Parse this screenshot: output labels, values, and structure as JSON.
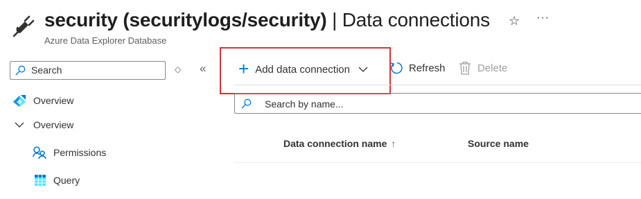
{
  "header": {
    "title_bold": "security (securitylogs/security)",
    "title_rest": " | Data connections",
    "subtitle": "Azure Data Explorer Database",
    "favorite_icon": "star-icon",
    "more_icon": "ellipsis-icon",
    "more_glyph": "···"
  },
  "sidebar": {
    "search_placeholder": "Search",
    "sort_glyph": "◇",
    "collapse_glyph": "«",
    "items": [
      {
        "label": "Overview",
        "icon": "overview-icon"
      },
      {
        "label": "Overview",
        "icon": "chevron-down-icon",
        "expanded": true
      },
      {
        "label": "Permissions",
        "icon": "permissions-icon"
      },
      {
        "label": "Query",
        "icon": "query-grid-icon"
      }
    ]
  },
  "toolbar": {
    "add_label": "Add data connection",
    "refresh_label": "Refresh",
    "delete_label": "Delete",
    "accent_color": "#0078d4",
    "highlight_color": "#d13438"
  },
  "main": {
    "search_placeholder": "Search by name...",
    "columns": [
      {
        "label": "Data connection name",
        "sort": "↑"
      },
      {
        "label": "Source name"
      }
    ]
  }
}
